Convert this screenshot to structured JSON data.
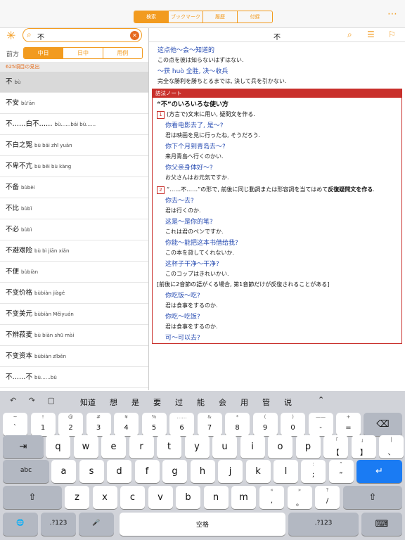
{
  "topbar": {
    "tabs": [
      "検索",
      "ブックマーク",
      "履歴",
      "付録"
    ],
    "active_tab": 0,
    "more": "⋯"
  },
  "search": {
    "value": "不",
    "direction_label": "前方",
    "modes": [
      "中日",
      "日中",
      "用例"
    ],
    "active_mode": 0,
    "result_count": "625項目の見出"
  },
  "results": [
    {
      "hz": "不",
      "py": "bù"
    },
    {
      "hz": "不安",
      "py": "bù'ān"
    },
    {
      "hz": "不……白不……",
      "py": "bù……bái bù……"
    },
    {
      "hz": "不白之冤",
      "py": "bù bái zhī yuān"
    },
    {
      "hz": "不卑不亢",
      "py": "bù bēi bù kàng"
    },
    {
      "hz": "不备",
      "py": "bùbèi"
    },
    {
      "hz": "不比",
      "py": "bùbǐ"
    },
    {
      "hz": "不必",
      "py": "bùbì"
    },
    {
      "hz": "不避艰险",
      "py": "bù bì jiān xiǎn"
    },
    {
      "hz": "不便",
      "py": "bùbiàn"
    },
    {
      "hz": "不变价格",
      "py": "bùbiàn jiàgé"
    },
    {
      "hz": "不变美元",
      "py": "bùbiàn Měiyuán"
    },
    {
      "hz": "不辨菽麦",
      "py": "bù biàn shū mài"
    },
    {
      "hz": "不变资本",
      "py": "bùbiàn zīběn"
    },
    {
      "hz": "不……不",
      "py": "bù……bù"
    }
  ],
  "entry": {
    "title": "不",
    "examples_top": [
      {
        "zh": "这点他～会～知道的",
        "ja": "この点を彼は知らないはずはない."
      },
      {
        "zh": "～获 huò 全胜, 决～收兵",
        "ja": "完全な勝利を勝ちとるまでは, 決して兵を引かない."
      }
    ],
    "note": {
      "header": "語法ノート",
      "title": "“不”のいろいろな使い方",
      "s1_num": "1",
      "s1_text": "(方言で)文末に用い, 疑問文を作る.",
      "s1_examples": [
        {
          "zh": "你看电影去了, 是～?",
          "ja": "君は映画を見に行ったね, そうだろう."
        },
        {
          "zh": "你下个月到青岛去～?",
          "ja": "来月青島へ行くのかい."
        },
        {
          "zh": "你父亲身体好～?",
          "ja": "お父さんはお元気ですか."
        }
      ],
      "s2_num": "2",
      "s2_text": "“……不……”の形で, 前後に同じ動詞または形容詞を当てはめて",
      "s2_bold": "反復疑問文を作る",
      "s2_end": ".",
      "s2_examples": [
        {
          "zh": "你去～去?",
          "ja": "君は行くのか."
        },
        {
          "zh": "这是～是你的笔?",
          "ja": "これは君のペンですか."
        },
        {
          "zh": "你能～能把这本书借给我?",
          "ja": "この本を貸してくれないか."
        },
        {
          "zh": "这杯子干净～干净?",
          "ja": "このコップはきれいかい."
        }
      ],
      "bracket": "[前後に2音節の語がくる場合, 第1音節だけが反復されることがある]",
      "s3_examples": [
        {
          "zh": "你吃饭～吃?",
          "ja": "君は食事をするのか."
        },
        {
          "zh": "你吃～吃饭?",
          "ja": "君は食事をするのか."
        },
        {
          "zh": "可～可以去?",
          "ja": ""
        }
      ]
    }
  },
  "keyboard": {
    "suggestions": [
      "知道",
      "想",
      "是",
      "要",
      "过",
      "能",
      "会",
      "用",
      "管",
      "说"
    ],
    "row1": [
      {
        "top": "~",
        "bot": "`"
      },
      {
        "top": "!",
        "bot": "1"
      },
      {
        "top": "@",
        "bot": "2"
      },
      {
        "top": "#",
        "bot": "3"
      },
      {
        "top": "¥",
        "bot": "4"
      },
      {
        "top": "%",
        "bot": "5"
      },
      {
        "top": "……",
        "bot": "6"
      },
      {
        "top": "&",
        "bot": "7"
      },
      {
        "top": "*",
        "bot": "8"
      },
      {
        "top": "(",
        "bot": "9"
      },
      {
        "top": ")",
        "bot": "0"
      },
      {
        "top": "——",
        "bot": "-"
      },
      {
        "top": "+",
        "bot": "="
      }
    ],
    "row2": [
      "q",
      "w",
      "e",
      "r",
      "t",
      "y",
      "u",
      "i",
      "o",
      "p"
    ],
    "row2_extra": [
      {
        "top": "「",
        "bot": "【"
      },
      {
        "top": "」",
        "bot": "】"
      },
      {
        "top": "|",
        "bot": "、"
      }
    ],
    "tab_label": "⇥",
    "abc_label": "abc",
    "row3": [
      "a",
      "s",
      "d",
      "f",
      "g",
      "h",
      "j",
      "k",
      "l"
    ],
    "row3_extra": [
      {
        "top": ":",
        "bot": ";"
      },
      {
        "top": "”",
        "bot": "“"
      }
    ],
    "return_label": "↵",
    "shift_label": "⇧",
    "row4": [
      "z",
      "x",
      "c",
      "v",
      "b",
      "n",
      "m"
    ],
    "row4_extra": [
      {
        "top": "«",
        "bot": ","
      },
      {
        "top": "»",
        "bot": "。"
      },
      {
        "top": "?",
        "bot": "/"
      }
    ],
    "globe_label": "🌐",
    "num_label": ".?123",
    "mic_label": "🎤",
    "space_label": "空格",
    "hide_label": "⌨",
    "delete_label": "⌫"
  }
}
